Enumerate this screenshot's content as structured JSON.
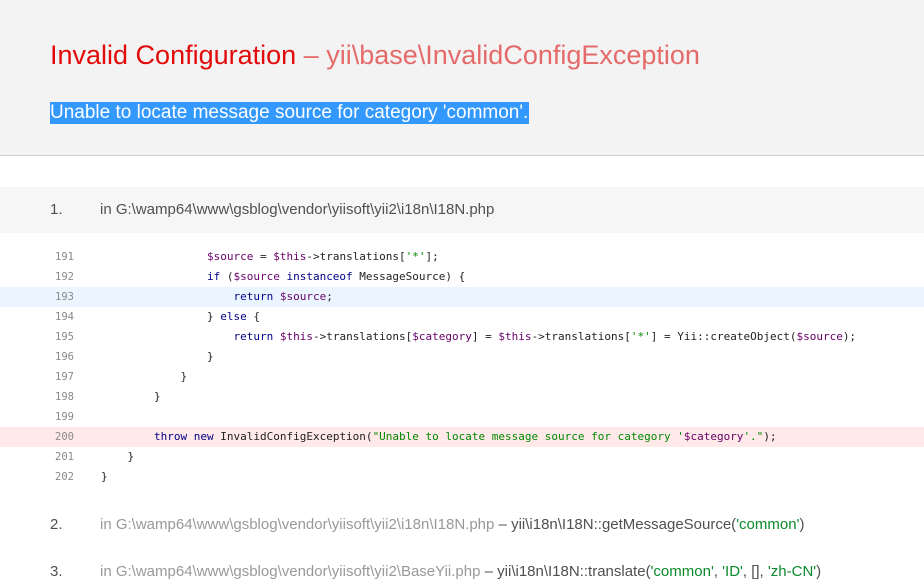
{
  "header": {
    "title": "Invalid Configuration",
    "separator": "–",
    "exception_class": "yii\\base\\InvalidConfigException",
    "message": "Unable to locate message source for category 'common'."
  },
  "frame1": {
    "number": "1.",
    "path": "in G:\\wamp64\\www\\gsblog\\vendor\\yiisoft\\yii2\\i18n\\I18N.php"
  },
  "code": {
    "line_numbers": [
      "191",
      "192",
      "193",
      "194",
      "195",
      "196",
      "197",
      "198",
      "199",
      "200",
      "201",
      "202"
    ],
    "highlight_line": "193",
    "error_line": "200"
  },
  "frame2": {
    "number": "2.",
    "path": "in G:\\wamp64\\www\\gsblog\\vendor\\yiisoft\\yii2\\i18n\\I18N.php",
    "dash": "–",
    "call": "yii\\i18n\\I18N::getMessageSource(",
    "arg": "'common'",
    "close": ")"
  },
  "frame3": {
    "number": "3.",
    "path": "in G:\\wamp64\\www\\gsblog\\vendor\\yiisoft\\yii2\\BaseYii.php",
    "dash": "–",
    "call": "yii\\i18n\\I18N::translate(",
    "arg1": "'common'",
    "sep1": ", ",
    "arg2": "'ID'",
    "sep2": ", [], ",
    "arg3": "'zh-CN'",
    "close": ")"
  }
}
